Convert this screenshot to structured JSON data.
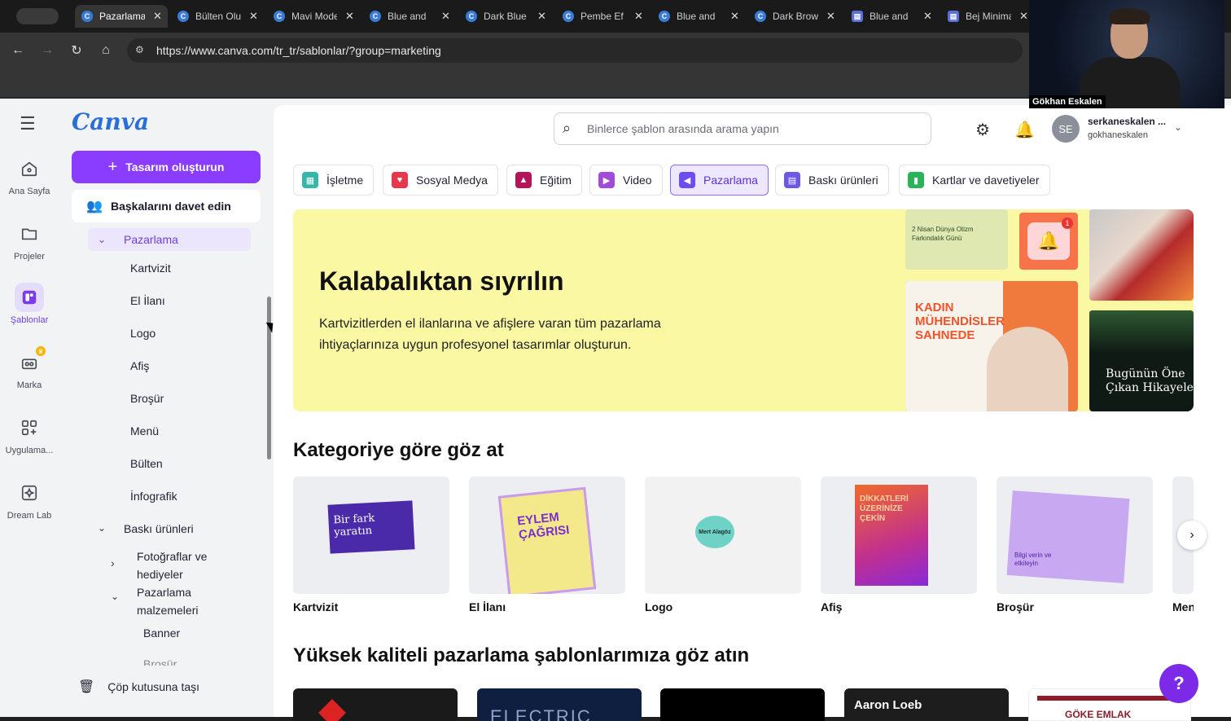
{
  "browser": {
    "tabs": [
      {
        "title": "Pazarlama",
        "active": true,
        "icon": "canva-favicon"
      },
      {
        "title": "Bülten Oluştur",
        "active": false,
        "icon": "canva-favicon"
      },
      {
        "title": "Mavi Modern",
        "active": false,
        "icon": "canva-favicon"
      },
      {
        "title": "Blue and",
        "active": false,
        "icon": "canva-favicon"
      },
      {
        "title": "Dark Blue",
        "active": false,
        "icon": "canva-favicon"
      },
      {
        "title": "Pembe Ef",
        "active": false,
        "icon": "canva-favicon"
      },
      {
        "title": "Blue and",
        "active": false,
        "icon": "canva-favicon"
      },
      {
        "title": "Dark Brown",
        "active": false,
        "icon": "canva-favicon"
      },
      {
        "title": "Blue and",
        "active": false,
        "icon": "doc-favicon"
      },
      {
        "title": "Bej Minimal",
        "active": false,
        "icon": "doc-favicon"
      }
    ],
    "url": "https://www.canva.com/tr_tr/sablonlar/?group=marketing"
  },
  "webcam": {
    "name": "Gökhan Eskalen"
  },
  "rail": {
    "menu_icon": "hamburger-icon",
    "items": [
      {
        "label": "Ana Sayfa",
        "icon": "home-icon"
      },
      {
        "label": "Projeler",
        "icon": "folder-icon"
      },
      {
        "label": "Şablonlar",
        "icon": "templates-icon"
      },
      {
        "label": "Marka",
        "icon": "brand-icon"
      },
      {
        "label": "Uygulama...",
        "icon": "apps-icon"
      },
      {
        "label": "Dream Lab",
        "icon": "dream-lab-icon"
      }
    ]
  },
  "panel": {
    "logo": "Canva",
    "create_label": "Tasarım oluşturun",
    "invite_label": "Başkalarını davet edin",
    "tree": {
      "marketing": "Pazarlama",
      "marketing_children": [
        "Kartvizit",
        "El İlanı",
        "Logo",
        "Afiş",
        "Broşür",
        "Menü",
        "Bülten",
        "İnfografik"
      ],
      "print": "Baskı ürünleri",
      "photos": "Fotoğraflar ve hediyeler",
      "materials": "Pazarlama malzemeleri",
      "banner": "Banner",
      "partial": "Broşür"
    },
    "trash_label": "Çöp kutusuna taşı"
  },
  "header": {
    "search_placeholder": "Binlerce şablon arasında arama yapın",
    "user_initials": "SE",
    "user_name": "serkaneskalen ...",
    "user_team": "gokhaneskalen"
  },
  "chips": [
    {
      "label": "İşletme",
      "color": "#35b6a8"
    },
    {
      "label": "Sosyal Medya",
      "color": "#e8374d"
    },
    {
      "label": "Eğitim",
      "color": "#b5145a"
    },
    {
      "label": "Video",
      "color": "#a24bd8"
    },
    {
      "label": "Pazarlama",
      "color": "#6d4df2",
      "active": true
    },
    {
      "label": "Baskı ürünleri",
      "color": "#6d58e6"
    },
    {
      "label": "Kartlar ve davetiyeler",
      "color": "#2bb35a"
    }
  ],
  "hero": {
    "title": "Kalabalıktan sıyrılın",
    "text": "Kartvizitlerden el ilanlarına ve afişlere varan tüm pazarlama ihtiyaçlarınıza uygun profesyonel tasarımlar oluşturun.",
    "tiles": {
      "tile1_line1": "2 Nisan Dünya Otizm",
      "tile1_line2": "Farkındalık Günü",
      "tile3_line1": "KADIN",
      "tile3_line2": "MÜHENDİSLER",
      "tile3_line3": "SAHNEDE",
      "tile5_line1": "Bugünün Öne",
      "tile5_line2": "Çıkan Hikayeler",
      "notif_badge": "1"
    }
  },
  "categories": {
    "title": "Kategoriye göre göz at",
    "items": [
      "Kartvizit",
      "El İlanı",
      "Logo",
      "Afiş",
      "Broşür",
      "Menü"
    ],
    "thumb_text": {
      "card": "Bir fark yaratın",
      "flyer": "EYLEM ÇAĞRISI",
      "logo": "Mert Alagöz",
      "poster": "DİKKATLERİ ÜZERİNİZE ÇEKİN",
      "brochure": "Bilgi verin ve etkileyin"
    }
  },
  "quality": {
    "title": "Yüksek kaliteli pazarlama şablonlarımıza göz atın",
    "tpl_texts": [
      "ELECTRIC",
      "Aaron Loeb",
      "GÖKE EMLAK"
    ]
  },
  "help_label": "?"
}
